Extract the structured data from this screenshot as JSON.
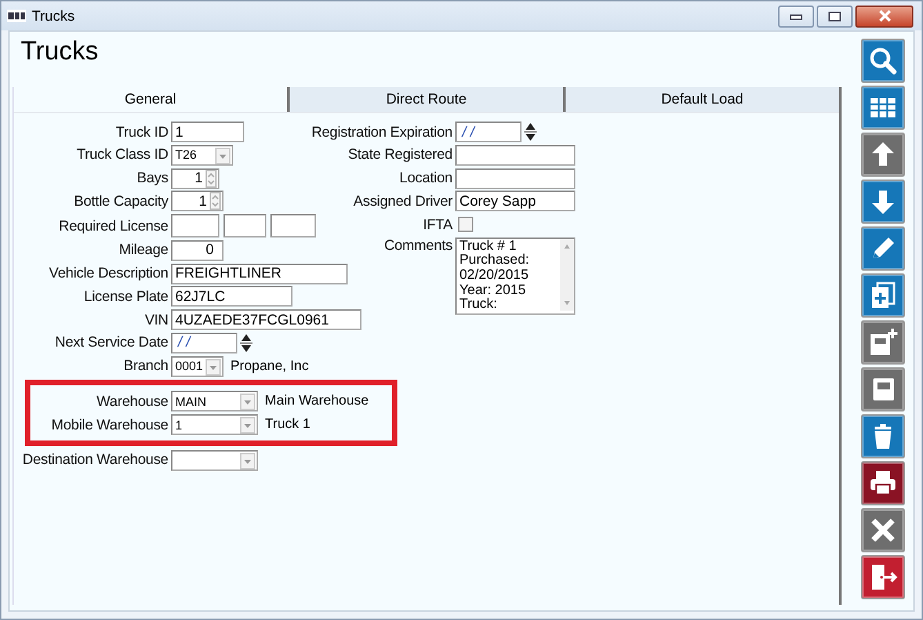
{
  "window": {
    "title": "Trucks"
  },
  "heading": "Trucks",
  "tabs": [
    {
      "label": "General",
      "selected": true
    },
    {
      "label": "Direct Route",
      "selected": false
    },
    {
      "label": "Default Load",
      "selected": false
    }
  ],
  "left_fields": [
    {
      "kind": "text",
      "label": "Truck ID",
      "value": "1",
      "highlighted": false
    },
    {
      "kind": "combo",
      "label": "Truck Class ID",
      "value": "T26",
      "highlighted": false
    },
    {
      "kind": "spin",
      "label": "Bays",
      "value": "1",
      "highlighted": false
    },
    {
      "kind": "spin",
      "label": "Bottle Capacity",
      "value": "1",
      "highlighted": false
    },
    {
      "kind": "license",
      "label": "Required License",
      "highlighted": false
    },
    {
      "kind": "number",
      "label": "Mileage",
      "value": "0",
      "highlighted": false
    },
    {
      "kind": "text",
      "label": "Vehicle Description",
      "value": "FREIGHTLINER",
      "highlighted": false
    },
    {
      "kind": "text",
      "label": "License Plate",
      "value": "62J7LC",
      "highlighted": false
    },
    {
      "kind": "text",
      "label": "VIN",
      "value": "4UZAEDE37FCGL0961",
      "highlighted": false
    },
    {
      "kind": "date",
      "label": "Next Service Date",
      "value": "/ /",
      "highlighted": false
    },
    {
      "kind": "combo",
      "label": "Branch",
      "value": "0001",
      "description": "Propane, Inc",
      "highlighted": false
    },
    {
      "kind": "combo",
      "label": "Warehouse",
      "value": "MAIN",
      "description": "Main Warehouse",
      "highlighted": true
    },
    {
      "kind": "combo",
      "label": "Mobile Warehouse",
      "value": "1",
      "description": "Truck 1",
      "highlighted": true
    },
    {
      "kind": "combo",
      "label": "Destination Warehouse",
      "highlighted": false
    }
  ],
  "right_fields": [
    {
      "kind": "date",
      "label": "Registration Expiration",
      "value": "/ /"
    },
    {
      "kind": "text",
      "label": "State Registered"
    },
    {
      "kind": "text",
      "label": "Location"
    },
    {
      "kind": "text",
      "label": "Assigned Driver",
      "value": "Corey Sapp"
    },
    {
      "kind": "checkbox",
      "label": "IFTA",
      "checked": false
    },
    {
      "kind": "memo",
      "label": "Comments",
      "lines": [
        "Truck # 1",
        "Purchased:",
        "02/20/2015",
        "Year: 2015",
        "Truck:"
      ]
    }
  ],
  "toolbar": [
    {
      "kind": "search",
      "color": "#1677b8"
    },
    {
      "kind": "grid",
      "color": "#1677b8"
    },
    {
      "kind": "up",
      "color": "#6e6e6e"
    },
    {
      "kind": "down",
      "color": "#1677b8"
    },
    {
      "kind": "edit",
      "color": "#1677b8"
    },
    {
      "kind": "copy",
      "color": "#1677b8"
    },
    {
      "kind": "save-new",
      "color": "#6e6e6e"
    },
    {
      "kind": "save",
      "color": "#6e6e6e"
    },
    {
      "kind": "delete",
      "color": "#1677b8"
    },
    {
      "kind": "print",
      "color": "#8a1324"
    },
    {
      "kind": "cancel",
      "color": "#6e6e6e"
    },
    {
      "kind": "exit",
      "color": "#c21f30"
    }
  ]
}
